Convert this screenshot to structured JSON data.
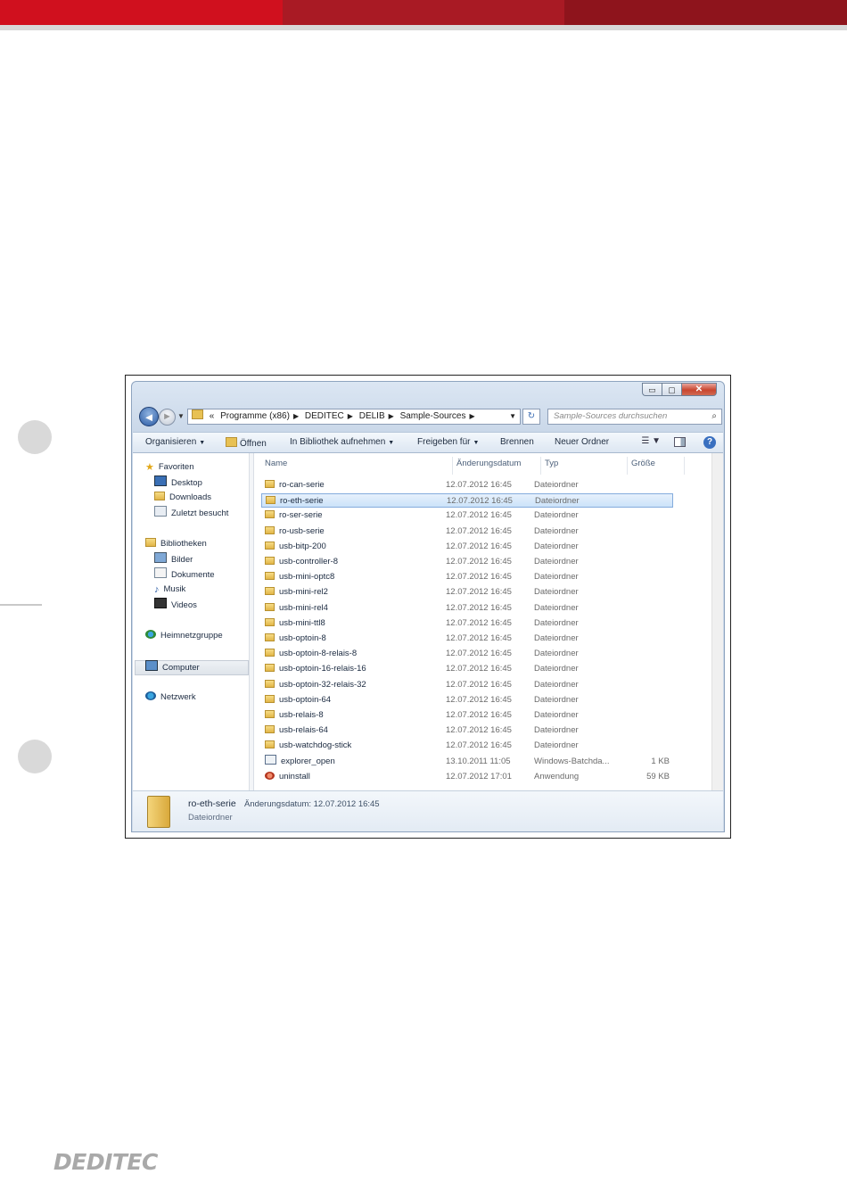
{
  "colors": {
    "bar1": "#d0101e",
    "bar2": "#a91a24",
    "bar3": "#8e141c"
  },
  "window": {
    "controls": {
      "minimize": "▭",
      "maximize": "▢",
      "close": "✕"
    },
    "address_parts": [
      "«",
      "Programme (x86)",
      "DEDITEC",
      "DELIB",
      "Sample-Sources"
    ],
    "search_placeholder": "Sample-Sources durchsuchen",
    "toolbar": {
      "organize": "Organisieren",
      "open": "Öffnen",
      "library": "In Bibliothek aufnehmen",
      "share": "Freigeben für",
      "burn": "Brennen",
      "new_folder": "Neuer Ordner",
      "help": "?"
    },
    "nav": {
      "favorites": "Favoriten",
      "desktop": "Desktop",
      "downloads": "Downloads",
      "recent": "Zuletzt besucht",
      "libraries": "Bibliotheken",
      "pictures": "Bilder",
      "documents": "Dokumente",
      "music": "Musik",
      "videos": "Videos",
      "homegroup": "Heimnetzgruppe",
      "computer": "Computer",
      "network": "Netzwerk"
    },
    "columns": {
      "name": "Name",
      "date": "Änderungsdatum",
      "type": "Typ",
      "size": "Größe"
    },
    "files": [
      {
        "name": "ro-can-serie",
        "date": "12.07.2012 16:45",
        "type": "Dateiordner",
        "size": "",
        "icon": "folder-icon"
      },
      {
        "name": "ro-eth-serie",
        "date": "12.07.2012 16:45",
        "type": "Dateiordner",
        "size": "",
        "icon": "folder-icon"
      },
      {
        "name": "ro-ser-serie",
        "date": "12.07.2012 16:45",
        "type": "Dateiordner",
        "size": "",
        "icon": "folder-icon"
      },
      {
        "name": "ro-usb-serie",
        "date": "12.07.2012 16:45",
        "type": "Dateiordner",
        "size": "",
        "icon": "folder-icon"
      },
      {
        "name": "usb-bitp-200",
        "date": "12.07.2012 16:45",
        "type": "Dateiordner",
        "size": "",
        "icon": "folder-icon"
      },
      {
        "name": "usb-controller-8",
        "date": "12.07.2012 16:45",
        "type": "Dateiordner",
        "size": "",
        "icon": "folder-icon"
      },
      {
        "name": "usb-mini-optc8",
        "date": "12.07.2012 16:45",
        "type": "Dateiordner",
        "size": "",
        "icon": "folder-icon"
      },
      {
        "name": "usb-mini-rel2",
        "date": "12.07.2012 16:45",
        "type": "Dateiordner",
        "size": "",
        "icon": "folder-icon"
      },
      {
        "name": "usb-mini-rel4",
        "date": "12.07.2012 16:45",
        "type": "Dateiordner",
        "size": "",
        "icon": "folder-icon"
      },
      {
        "name": "usb-mini-ttl8",
        "date": "12.07.2012 16:45",
        "type": "Dateiordner",
        "size": "",
        "icon": "folder-icon"
      },
      {
        "name": "usb-optoin-8",
        "date": "12.07.2012 16:45",
        "type": "Dateiordner",
        "size": "",
        "icon": "folder-icon"
      },
      {
        "name": "usb-optoin-8-relais-8",
        "date": "12.07.2012 16:45",
        "type": "Dateiordner",
        "size": "",
        "icon": "folder-icon"
      },
      {
        "name": "usb-optoin-16-relais-16",
        "date": "12.07.2012 16:45",
        "type": "Dateiordner",
        "size": "",
        "icon": "folder-icon"
      },
      {
        "name": "usb-optoin-32-relais-32",
        "date": "12.07.2012 16:45",
        "type": "Dateiordner",
        "size": "",
        "icon": "folder-icon"
      },
      {
        "name": "usb-optoin-64",
        "date": "12.07.2012 16:45",
        "type": "Dateiordner",
        "size": "",
        "icon": "folder-icon"
      },
      {
        "name": "usb-relais-8",
        "date": "12.07.2012 16:45",
        "type": "Dateiordner",
        "size": "",
        "icon": "folder-icon"
      },
      {
        "name": "usb-relais-64",
        "date": "12.07.2012 16:45",
        "type": "Dateiordner",
        "size": "",
        "icon": "folder-icon"
      },
      {
        "name": "usb-watchdog-stick",
        "date": "12.07.2012 16:45",
        "type": "Dateiordner",
        "size": "",
        "icon": "folder-icon"
      },
      {
        "name": "explorer_open",
        "date": "13.10.2011 11:05",
        "type": "Windows-Batchda...",
        "size": "1 KB",
        "icon": "batch-file-icon"
      },
      {
        "name": "uninstall",
        "date": "12.07.2012 17:01",
        "type": "Anwendung",
        "size": "59 KB",
        "icon": "application-icon"
      }
    ],
    "selected_index": 1,
    "details": {
      "name": "ro-eth-serie",
      "meta": "Änderungsdatum: 12.07.2012 16:45",
      "type": "Dateiordner"
    }
  },
  "logo": "DEDITEC"
}
